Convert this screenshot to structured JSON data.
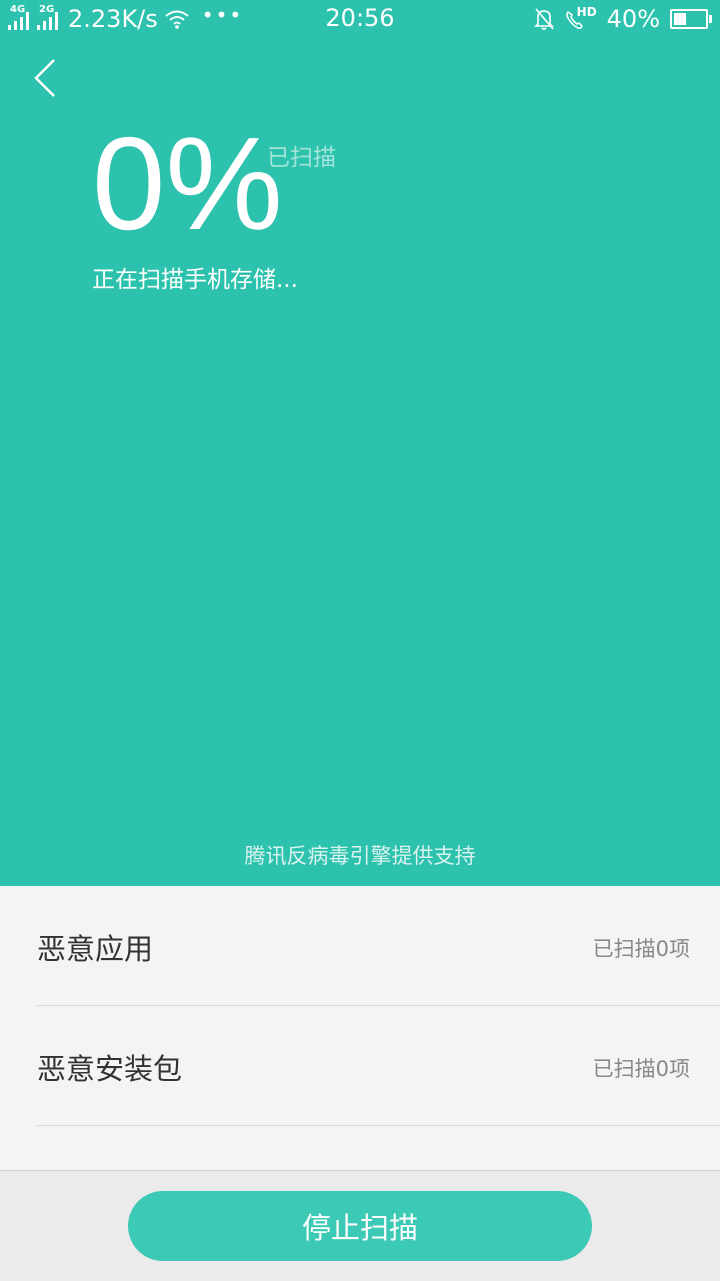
{
  "status_bar": {
    "signal1_type": "4G",
    "signal2_type": "2G",
    "net_speed": "2.23K/s",
    "time": "20:56",
    "battery_percent": "40%",
    "battery_level": 0.4,
    "hd_label": "HD",
    "icons": [
      "signal-4g-icon",
      "signal-2g-icon",
      "wifi-icon",
      "more-dots-icon",
      "mute-bell-icon",
      "hd-call-icon",
      "battery-icon"
    ]
  },
  "header": {
    "back_icon": "back-chevron-icon"
  },
  "scan": {
    "percent": "0%",
    "scanned_label": "已扫描",
    "status_text": "正在扫描手机存储...",
    "powered_by": "腾讯反病毒引擎提供支持"
  },
  "results": [
    {
      "label": "恶意应用",
      "count": "已扫描0项"
    },
    {
      "label": "恶意安装包",
      "count": "已扫描0项"
    }
  ],
  "actions": {
    "stop_label": "停止扫描"
  },
  "colors": {
    "accent": "#2dc2ad",
    "button": "#3cc9b5",
    "list_bg": "#f4f4f4"
  }
}
